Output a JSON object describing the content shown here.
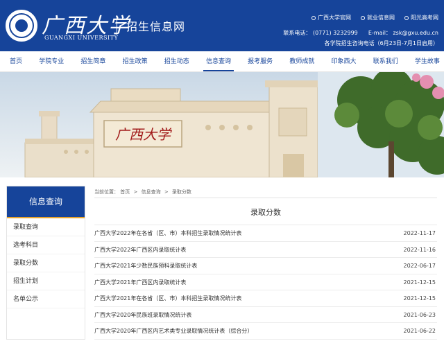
{
  "header": {
    "logo_cn": "广西大学",
    "logo_en": "GUANGXI UNIVERSITY",
    "site_title": "招生信息网",
    "toplinks": [
      {
        "label": "广西大学官网",
        "icon": "circle-bullet-icon"
      },
      {
        "label": "就业信息网",
        "icon": "circle-bullet-icon"
      },
      {
        "label": "阳光高考网",
        "icon": "circle-bullet-icon"
      }
    ],
    "contact": {
      "phone_label": "联系电话：",
      "phone": "(0771) 3232999",
      "email_label": "E-mail：",
      "email": "zsk@gxu.edu.cn"
    },
    "hours": "各学院招生咨询电话（6月23日-7月1日启用）"
  },
  "nav": {
    "items": [
      "首页",
      "学院专业",
      "招生简章",
      "招生政策",
      "招生动态",
      "信息查询",
      "报考服务",
      "教师成就",
      "印象西大",
      "联系我们",
      "学生故事"
    ],
    "active_index": 5
  },
  "banner": {
    "gate_inscription": "广西大学"
  },
  "sidebar": {
    "title": "信息查询",
    "items": [
      "录取查询",
      "选考科目",
      "录取分数",
      "招生计划",
      "名单公示"
    ]
  },
  "breadcrumb": {
    "prefix": "当前位置：",
    "items": [
      "首页",
      "信息查询",
      "录取分数"
    ],
    "separator": ">"
  },
  "main": {
    "title": "录取分数",
    "rows": [
      {
        "title": "广西大学2022年在各省（区、市）本科招生录取情况统计表",
        "date": "2022-11-17"
      },
      {
        "title": "广西大学2022年广西区内录取统计表",
        "date": "2022-11-16"
      },
      {
        "title": "广西大学2021年少数民族预科录取统计表",
        "date": "2022-06-17"
      },
      {
        "title": "广西大学2021年广西区内录取统计表",
        "date": "2021-12-15"
      },
      {
        "title": "广西大学2021年在各省（区、市）本科招生录取情况统计表",
        "date": "2021-12-15"
      },
      {
        "title": "广西大学2020年民族班录取情况统计表",
        "date": "2021-06-23"
      },
      {
        "title": "广西大学2020年广西区内艺术类专业录取情况统计表（综合分）",
        "date": "2021-06-22"
      }
    ]
  },
  "colors": {
    "brand_blue": "#16449a",
    "accent_orange": "#e8a42d",
    "inscription_red": "#a11a1a"
  }
}
